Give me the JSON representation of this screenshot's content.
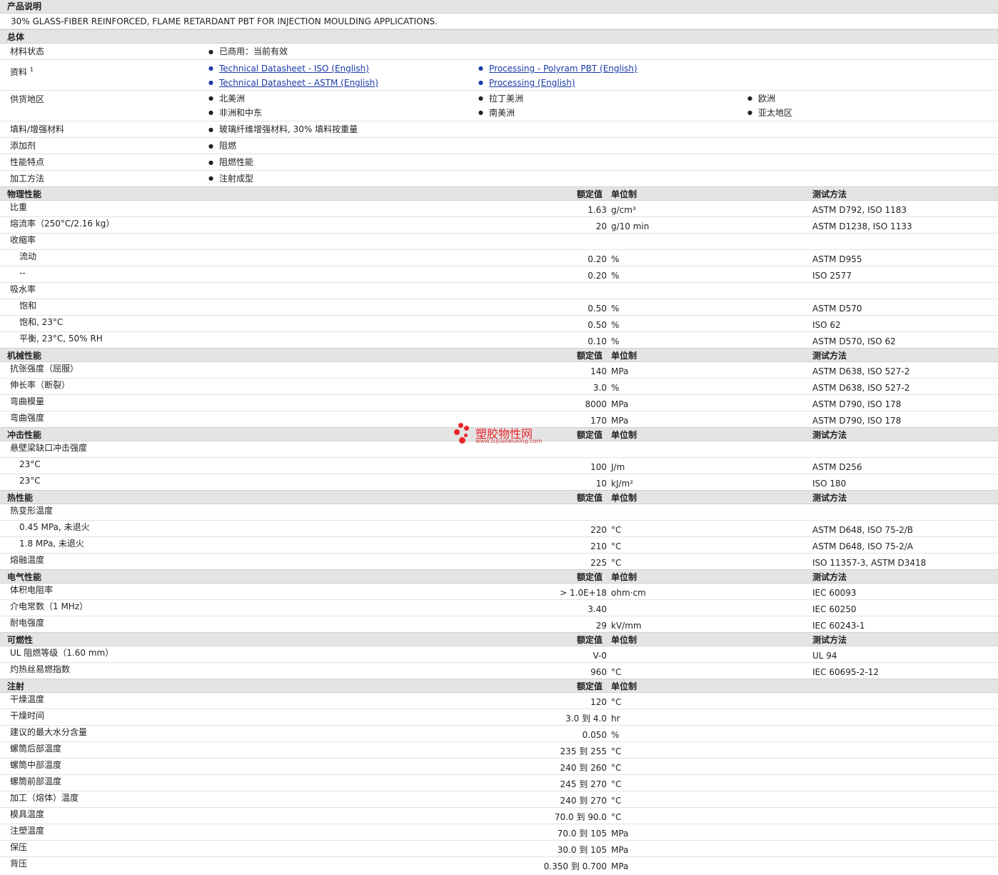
{
  "sections": {
    "desc_title": "产品说明",
    "overall_title": "总体",
    "physical_title": "物理性能",
    "mechanical_title": "机械性能",
    "impact_title": "冲击性能",
    "thermal_title": "热性能",
    "electrical_title": "电气性能",
    "flammability_title": "可燃性",
    "injection_title": "注射"
  },
  "headers": {
    "nominal": "额定值",
    "unit": "单位制",
    "test": "测试方法"
  },
  "description": "30% GLASS-FIBER REINFORCED, FLAME RETARDANT PBT FOR INJECTION MOULDING APPLICATIONS.",
  "overall": {
    "status_label": "材料状态",
    "status_value": "已商用：当前有效",
    "docs_label": "资料",
    "docs_sup": "1",
    "docs": [
      "Technical Datasheet - ISO (English)",
      "Technical Datasheet - ASTM (English)",
      "Processing - Polyram PBT (English)",
      "Processing (English)"
    ],
    "region_label": "供货地区",
    "regions": [
      "北美洲",
      "非洲和中东",
      "拉丁美洲",
      "南美洲",
      "欧洲",
      "亚太地区"
    ],
    "filler_label": "填料/增强材料",
    "filler_value": "玻璃纤维增强材料, 30% 填料按重量",
    "additive_label": "添加剂",
    "additive_value": "阻燃",
    "features_label": "性能特点",
    "features_value": "阻燃性能",
    "processing_label": "加工方法",
    "processing_value": "注射成型"
  },
  "physical": [
    {
      "label": "比重",
      "value": "1.63",
      "unit": "g/cm³",
      "test": "ASTM D792, ISO 1183"
    },
    {
      "label": "熔流率（250°C/2.16 kg）",
      "value": "20",
      "unit": "g/10 min",
      "test": "ASTM D1238, ISO 1133"
    },
    {
      "label": "收缩率",
      "value": "",
      "unit": "",
      "test": ""
    },
    {
      "label": "流动",
      "value": "0.20",
      "unit": "%",
      "test": "ASTM D955",
      "sub": true
    },
    {
      "label": "--",
      "value": "0.20",
      "unit": "%",
      "test": "ISO 2577",
      "sub": true
    },
    {
      "label": "吸水率",
      "value": "",
      "unit": "",
      "test": ""
    },
    {
      "label": "饱和",
      "value": "0.50",
      "unit": "%",
      "test": "ASTM D570",
      "sub": true
    },
    {
      "label": "饱和, 23°C",
      "value": "0.50",
      "unit": "%",
      "test": "ISO 62",
      "sub": true
    },
    {
      "label": "平衡, 23°C, 50% RH",
      "value": "0.10",
      "unit": "%",
      "test": "ASTM D570, ISO 62",
      "sub": true
    }
  ],
  "mechanical": [
    {
      "label": "抗张强度（屈服）",
      "value": "140",
      "unit": "MPa",
      "test": "ASTM D638, ISO 527-2"
    },
    {
      "label": "伸长率（断裂）",
      "value": "3.0",
      "unit": "%",
      "test": "ASTM D638, ISO 527-2"
    },
    {
      "label": "弯曲模量",
      "value": "8000",
      "unit": "MPa",
      "test": "ASTM D790, ISO 178"
    },
    {
      "label": "弯曲强度",
      "value": "170",
      "unit": "MPa",
      "test": "ASTM D790, ISO 178"
    }
  ],
  "impact": [
    {
      "label": "悬壁梁缺口冲击强度",
      "value": "",
      "unit": "",
      "test": ""
    },
    {
      "label": "23°C",
      "value": "100",
      "unit": "J/m",
      "test": "ASTM D256",
      "sub": true
    },
    {
      "label": "23°C",
      "value": "10",
      "unit": "kJ/m²",
      "test": "ISO 180",
      "sub": true
    }
  ],
  "thermal": [
    {
      "label": "热变形温度",
      "value": "",
      "unit": "",
      "test": ""
    },
    {
      "label": "0.45 MPa, 未退火",
      "value": "220",
      "unit": "°C",
      "test": "ASTM D648, ISO 75-2/B",
      "sub": true
    },
    {
      "label": "1.8 MPa, 未退火",
      "value": "210",
      "unit": "°C",
      "test": "ASTM D648, ISO 75-2/A",
      "sub": true
    },
    {
      "label": "熔融温度",
      "value": "225",
      "unit": "°C",
      "test": "ISO 11357-3, ASTM D3418"
    }
  ],
  "electrical": [
    {
      "label": "体积电阻率",
      "value": "> 1.0E+18",
      "unit": "ohm·cm",
      "test": "IEC 60093"
    },
    {
      "label": "介电常数（1 MHz）",
      "value": "3.40",
      "unit": "",
      "test": "IEC 60250"
    },
    {
      "label": "耐电强度",
      "value": "29",
      "unit": "kV/mm",
      "test": "IEC 60243-1"
    }
  ],
  "flammability": [
    {
      "label": "UL 阻燃等级（1.60 mm）",
      "value": "V-0",
      "unit": "",
      "test": "UL 94"
    },
    {
      "label": "灼热丝易燃指数",
      "value": "960",
      "unit": "°C",
      "test": "IEC 60695-2-12"
    }
  ],
  "injection": [
    {
      "label": "干燥温度",
      "value": "120",
      "unit": "°C"
    },
    {
      "label": "干燥时间",
      "value": "3.0 到  4.0",
      "unit": "hr"
    },
    {
      "label": "建议的最大水分含量",
      "value": "0.050",
      "unit": "%"
    },
    {
      "label": "螺筒后部温度",
      "value": "235 到  255",
      "unit": "°C"
    },
    {
      "label": "螺筒中部温度",
      "value": "240 到  260",
      "unit": "°C"
    },
    {
      "label": "螺筒前部温度",
      "value": "245 到  270",
      "unit": "°C"
    },
    {
      "label": "加工（熔体）温度",
      "value": "240 到  270",
      "unit": "°C"
    },
    {
      "label": "模具温度",
      "value": "70.0 到  90.0",
      "unit": "°C"
    },
    {
      "label": "注塑温度",
      "value": "70.0 到  105",
      "unit": "MPa"
    },
    {
      "label": "保压",
      "value": "30.0 到  105",
      "unit": "MPa"
    },
    {
      "label": "背压",
      "value": "0.350 到  0.700",
      "unit": "MPa"
    }
  ],
  "watermark": {
    "title": "塑胶物性网",
    "url": "www.sujiaowuxing.com",
    "color": "#e8272b"
  }
}
